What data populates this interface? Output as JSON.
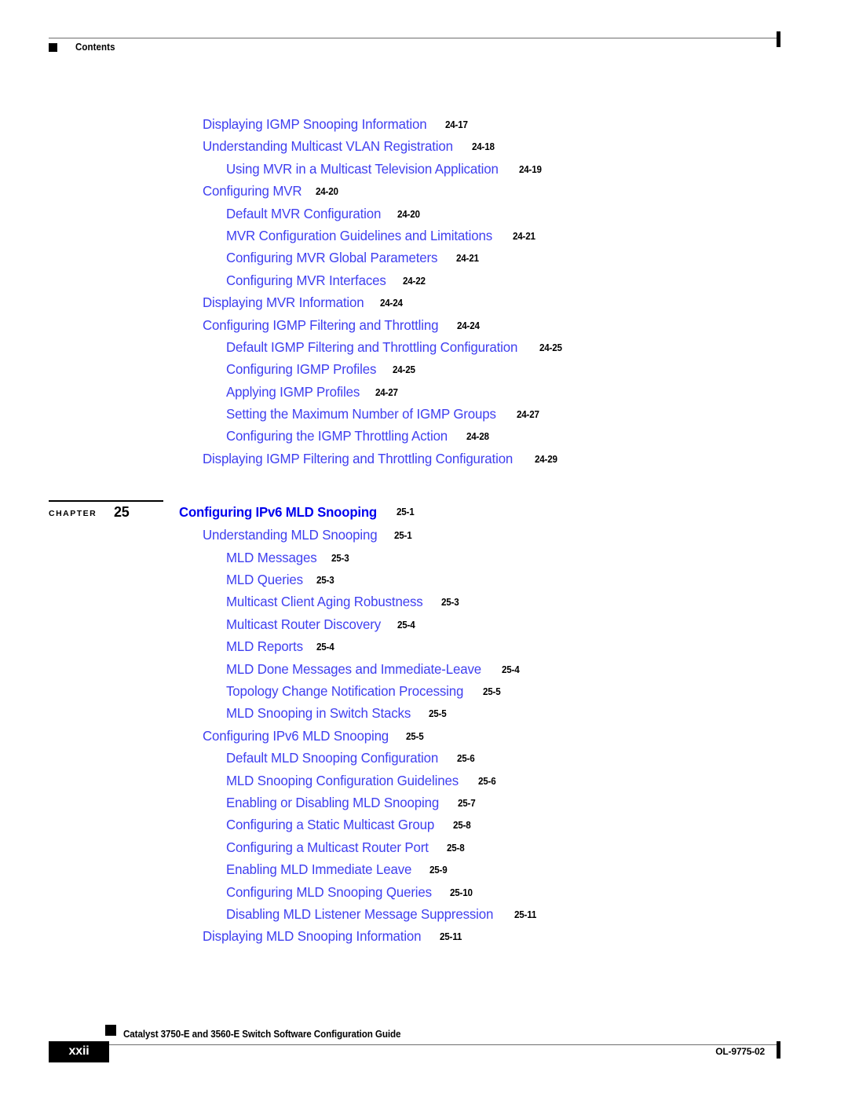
{
  "header": {
    "label": "Contents"
  },
  "toc": {
    "groups": [
      {
        "entries": [
          {
            "level": 1,
            "title": "Displaying IGMP Snooping Information",
            "page": "24-17"
          },
          {
            "level": 1,
            "title": "Understanding Multicast VLAN Registration",
            "page": "24-18"
          },
          {
            "level": 2,
            "title": "Using MVR in a Multicast Television Application",
            "page": "24-19"
          },
          {
            "level": 1,
            "title": "Configuring MVR",
            "page": "24-20"
          },
          {
            "level": 2,
            "title": "Default MVR Configuration",
            "page": "24-20"
          },
          {
            "level": 2,
            "title": "MVR Configuration Guidelines and Limitations",
            "page": "24-21"
          },
          {
            "level": 2,
            "title": "Configuring MVR Global Parameters",
            "page": "24-21"
          },
          {
            "level": 2,
            "title": "Configuring MVR Interfaces",
            "page": "24-22"
          },
          {
            "level": 1,
            "title": "Displaying MVR Information",
            "page": "24-24"
          },
          {
            "level": 1,
            "title": "Configuring IGMP Filtering and Throttling",
            "page": "24-24"
          },
          {
            "level": 2,
            "title": "Default IGMP Filtering and Throttling Configuration",
            "page": "24-25"
          },
          {
            "level": 2,
            "title": "Configuring IGMP Profiles",
            "page": "24-25"
          },
          {
            "level": 2,
            "title": "Applying IGMP Profiles",
            "page": "24-27"
          },
          {
            "level": 2,
            "title": "Setting the Maximum Number of IGMP Groups",
            "page": "24-27"
          },
          {
            "level": 2,
            "title": "Configuring the IGMP Throttling Action",
            "page": "24-28"
          },
          {
            "level": 1,
            "title": "Displaying IGMP Filtering and Throttling Configuration",
            "page": "24-29"
          }
        ]
      }
    ]
  },
  "chapter": {
    "word": "Chapter",
    "number": "25",
    "title": "Configuring IPv6 MLD Snooping",
    "page": "25-1",
    "entries": [
      {
        "level": 1,
        "title": "Understanding MLD Snooping",
        "page": "25-1"
      },
      {
        "level": 2,
        "title": "MLD Messages",
        "page": "25-3"
      },
      {
        "level": 2,
        "title": "MLD Queries",
        "page": "25-3"
      },
      {
        "level": 2,
        "title": "Multicast Client Aging Robustness",
        "page": "25-3"
      },
      {
        "level": 2,
        "title": "Multicast Router Discovery",
        "page": "25-4"
      },
      {
        "level": 2,
        "title": "MLD Reports",
        "page": "25-4"
      },
      {
        "level": 2,
        "title": "MLD Done Messages and Immediate-Leave",
        "page": "25-4"
      },
      {
        "level": 2,
        "title": "Topology Change Notification Processing",
        "page": "25-5"
      },
      {
        "level": 2,
        "title": "MLD Snooping in Switch Stacks",
        "page": "25-5"
      },
      {
        "level": 1,
        "title": "Configuring IPv6 MLD Snooping",
        "page": "25-5"
      },
      {
        "level": 2,
        "title": "Default MLD Snooping Configuration",
        "page": "25-6"
      },
      {
        "level": 2,
        "title": "MLD Snooping Configuration Guidelines",
        "page": "25-6"
      },
      {
        "level": 2,
        "title": "Enabling or Disabling MLD Snooping",
        "page": "25-7"
      },
      {
        "level": 2,
        "title": "Configuring a Static Multicast Group",
        "page": "25-8"
      },
      {
        "level": 2,
        "title": "Configuring a Multicast Router Port",
        "page": "25-8"
      },
      {
        "level": 2,
        "title": "Enabling MLD Immediate Leave",
        "page": "25-9"
      },
      {
        "level": 2,
        "title": "Configuring MLD Snooping Queries",
        "page": "25-10"
      },
      {
        "level": 2,
        "title": "Disabling MLD Listener Message Suppression",
        "page": "25-11"
      },
      {
        "level": 1,
        "title": "Displaying MLD Snooping Information",
        "page": "25-11"
      }
    ]
  },
  "footer": {
    "page_number": "xxii",
    "guide_title": "Catalyst 3750-E and 3560-E Switch Software Configuration Guide",
    "doc_id": "OL-9775-02"
  },
  "colors": {
    "link_blue": "#3f3ff0",
    "chapter_blue": "#0000ee",
    "text_black": "#000000",
    "rule_gray": "#6e6e6e"
  }
}
